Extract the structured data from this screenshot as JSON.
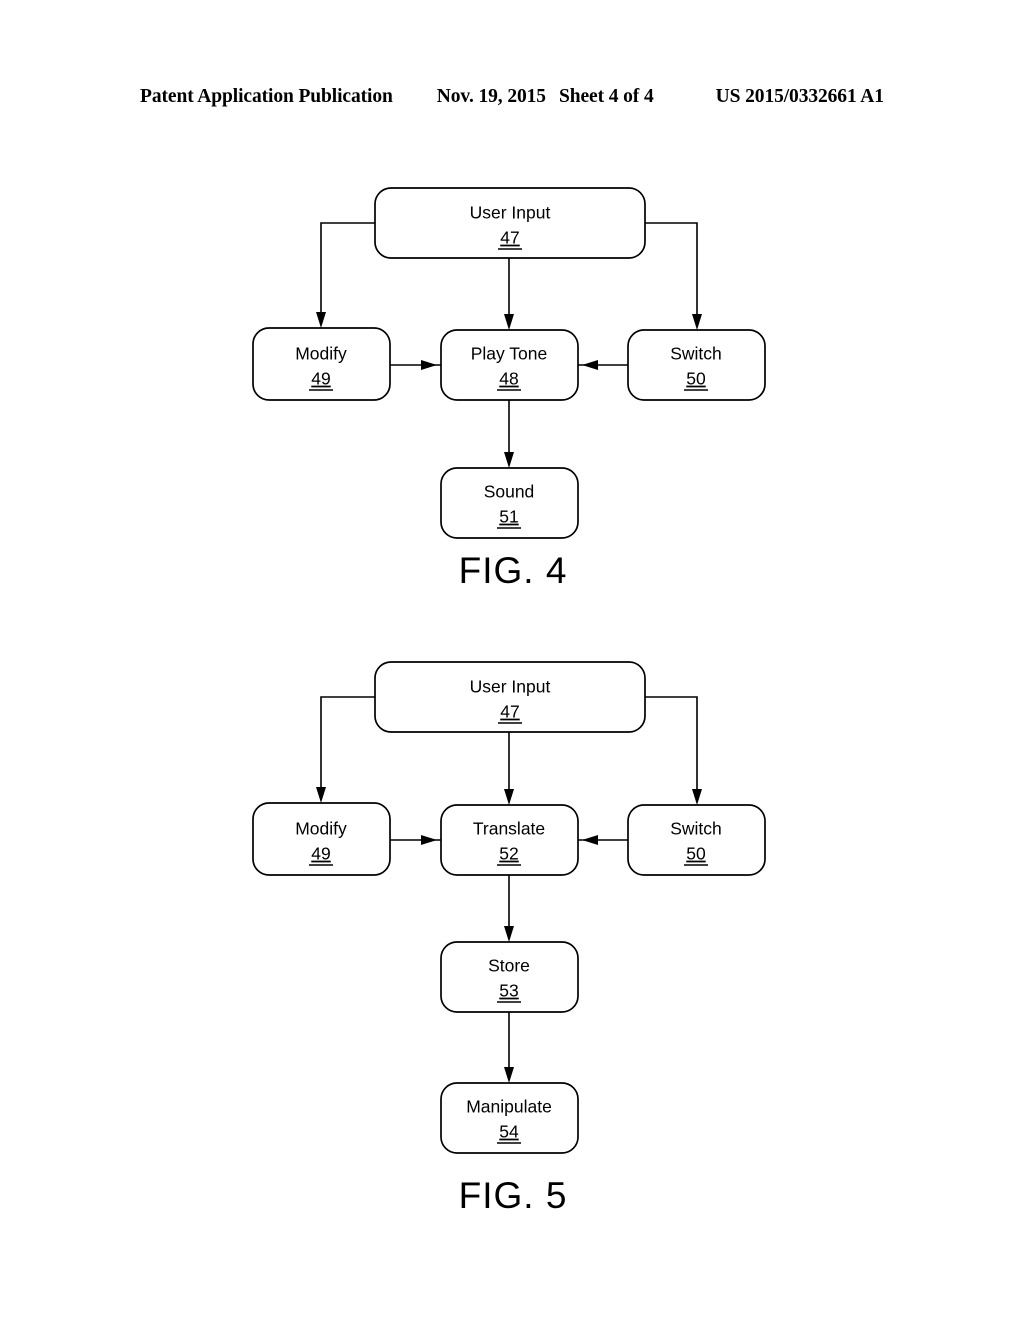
{
  "header": {
    "publication": "Patent Application Publication",
    "date": "Nov. 19, 2015",
    "sheet": "Sheet 4 of 4",
    "number": "US 2015/0332661 A1"
  },
  "figures": [
    {
      "id": "fig-4",
      "caption": "FIG. 4",
      "nodes": [
        {
          "id": "user-input",
          "label": "User Input",
          "ref": "47"
        },
        {
          "id": "modify",
          "label": "Modify",
          "ref": "49"
        },
        {
          "id": "play-tone",
          "label": "Play Tone",
          "ref": "48"
        },
        {
          "id": "switch",
          "label": "Switch",
          "ref": "50"
        },
        {
          "id": "sound",
          "label": "Sound",
          "ref": "51"
        }
      ],
      "connections": [
        {
          "from": "user-input",
          "to": "modify"
        },
        {
          "from": "user-input",
          "to": "play-tone"
        },
        {
          "from": "user-input",
          "to": "switch"
        },
        {
          "from": "modify",
          "to": "play-tone"
        },
        {
          "from": "switch",
          "to": "play-tone"
        },
        {
          "from": "play-tone",
          "to": "sound"
        }
      ]
    },
    {
      "id": "fig-5",
      "caption": "FIG. 5",
      "nodes": [
        {
          "id": "user-input",
          "label": "User Input",
          "ref": "47"
        },
        {
          "id": "modify",
          "label": "Modify",
          "ref": "49"
        },
        {
          "id": "translate",
          "label": "Translate",
          "ref": "52"
        },
        {
          "id": "switch",
          "label": "Switch",
          "ref": "50"
        },
        {
          "id": "store",
          "label": "Store",
          "ref": "53"
        },
        {
          "id": "manipulate",
          "label": "Manipulate",
          "ref": "54"
        }
      ],
      "connections": [
        {
          "from": "user-input",
          "to": "modify"
        },
        {
          "from": "user-input",
          "to": "translate"
        },
        {
          "from": "user-input",
          "to": "switch"
        },
        {
          "from": "modify",
          "to": "translate"
        },
        {
          "from": "switch",
          "to": "translate"
        },
        {
          "from": "translate",
          "to": "store"
        },
        {
          "from": "store",
          "to": "manipulate"
        }
      ]
    }
  ],
  "colors": {
    "ink": "#000000",
    "paper": "#ffffff"
  }
}
